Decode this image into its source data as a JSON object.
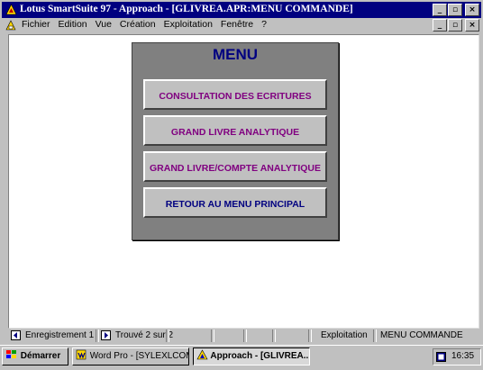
{
  "window": {
    "title": "Lotus SmartSuite 97   - Approach - [GLIVREA.APR:MENU COMMANDE]",
    "minimize": "_",
    "maximize": "▫",
    "close": "×"
  },
  "menubar": {
    "items": [
      "Fichier",
      "Edition",
      "Vue",
      "Création",
      "Exploitation",
      "Fenêtre",
      "?"
    ]
  },
  "panel": {
    "title": "MENU",
    "buttons": [
      "CONSULTATION DES ECRITURES",
      "GRAND LIVRE ANALYTIQUE",
      "GRAND LIVRE/COMPTE ANALYTIQUE",
      "RETOUR AU MENU PRINCIPAL"
    ]
  },
  "status": {
    "record": "Enregistrement 1",
    "found": "Trouvé 2 sur 2",
    "mode": "Exploitation",
    "view": "MENU COMMANDE"
  },
  "taskbar": {
    "start": "Démarrer",
    "tasks": [
      "Word Pro - [SYLEXLCOM...",
      "Approach - [GLIVREA..."
    ],
    "clock": "16:35"
  },
  "colors": {
    "titlebar": "#000080",
    "panel": "#808080",
    "menu_title": "#000080",
    "button_text": "#800080"
  }
}
